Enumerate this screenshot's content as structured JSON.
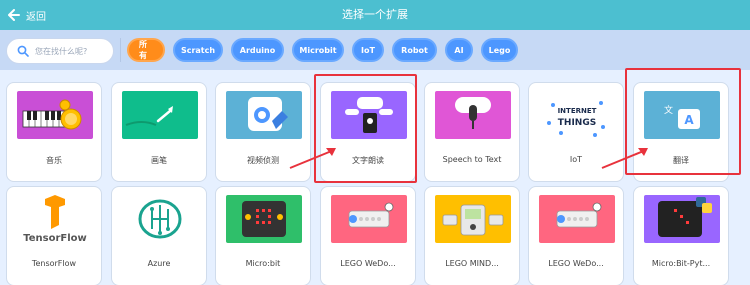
{
  "header": {
    "back_label": "返回",
    "title": "选择一个扩展"
  },
  "search": {
    "placeholder": "您在找什么呢?"
  },
  "tags": [
    "所有",
    "Scratch",
    "Arduino",
    "Microbit",
    "IoT",
    "Robot",
    "AI",
    "Lego"
  ],
  "cards": {
    "row1": [
      "音乐",
      "画笔",
      "视频侦测",
      "文字朗读",
      "Speech to Text",
      "IoT",
      "翻译"
    ],
    "row2": [
      "TensorFlow",
      "Azure",
      "Micro:bit",
      "LEGO WeDo...",
      "LEGO MIND...",
      "LEGO WeDo...",
      "Micro:Bit-Pyt..."
    ]
  },
  "tile_text": {
    "tensorflow": "TensorFlow",
    "iot_line1": "INTERNET",
    "iot_line2": "THINGS",
    "translate_a": "A",
    "translate_zh": "文"
  },
  "colors": {
    "header": "#4cbfd0",
    "tag": "#4d97ff",
    "tag_active": "#ff8c1a",
    "highlight": "#e8323c"
  }
}
